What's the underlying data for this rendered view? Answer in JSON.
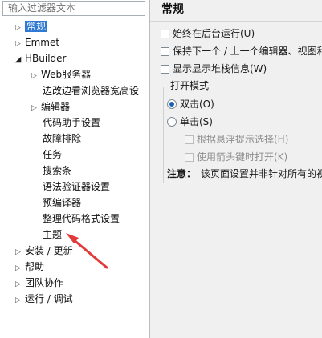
{
  "sidebar": {
    "filter_placeholder": "输入过滤器文本",
    "items": [
      {
        "label": "常规",
        "toggle": "▷",
        "selected": true
      },
      {
        "label": "Emmet",
        "toggle": "▷"
      },
      {
        "label": "HBuilder",
        "toggle": "◢"
      },
      {
        "label": "Web服务器",
        "toggle": "▷"
      },
      {
        "label": "边改边看浏览器宽高设",
        "toggle": ""
      },
      {
        "label": "编辑器",
        "toggle": "▷"
      },
      {
        "label": "代码助手设置",
        "toggle": ""
      },
      {
        "label": "故障排除",
        "toggle": ""
      },
      {
        "label": "任务",
        "toggle": ""
      },
      {
        "label": "搜索条",
        "toggle": ""
      },
      {
        "label": "语法验证器设置",
        "toggle": ""
      },
      {
        "label": "预编译器",
        "toggle": ""
      },
      {
        "label": "整理代码格式设置",
        "toggle": ""
      },
      {
        "label": "主题",
        "toggle": ""
      },
      {
        "label": "安装 / 更新",
        "toggle": "▷"
      },
      {
        "label": "帮助",
        "toggle": "▷"
      },
      {
        "label": "团队协作",
        "toggle": "▷"
      },
      {
        "label": "运行 / 调试",
        "toggle": "▷"
      }
    ]
  },
  "main": {
    "title": "常规",
    "options": {
      "run_in_background": "始终在后台运行(U)",
      "keep_next_prev": "保持下一个 / 上一个编辑器、视图和",
      "show_heap": "显示显示堆栈信息(W)"
    },
    "open_mode": {
      "label": "打开模式",
      "double_click": "双击(O)",
      "single_click": "单击(S)",
      "hover_select": "根据悬浮提示选择(H)",
      "arrow_open": "使用箭头键时打开(K)"
    },
    "note": {
      "label": "注意：",
      "text": "该页面设置并非针对所有的视"
    }
  },
  "annotation_color": "#e23a3a"
}
